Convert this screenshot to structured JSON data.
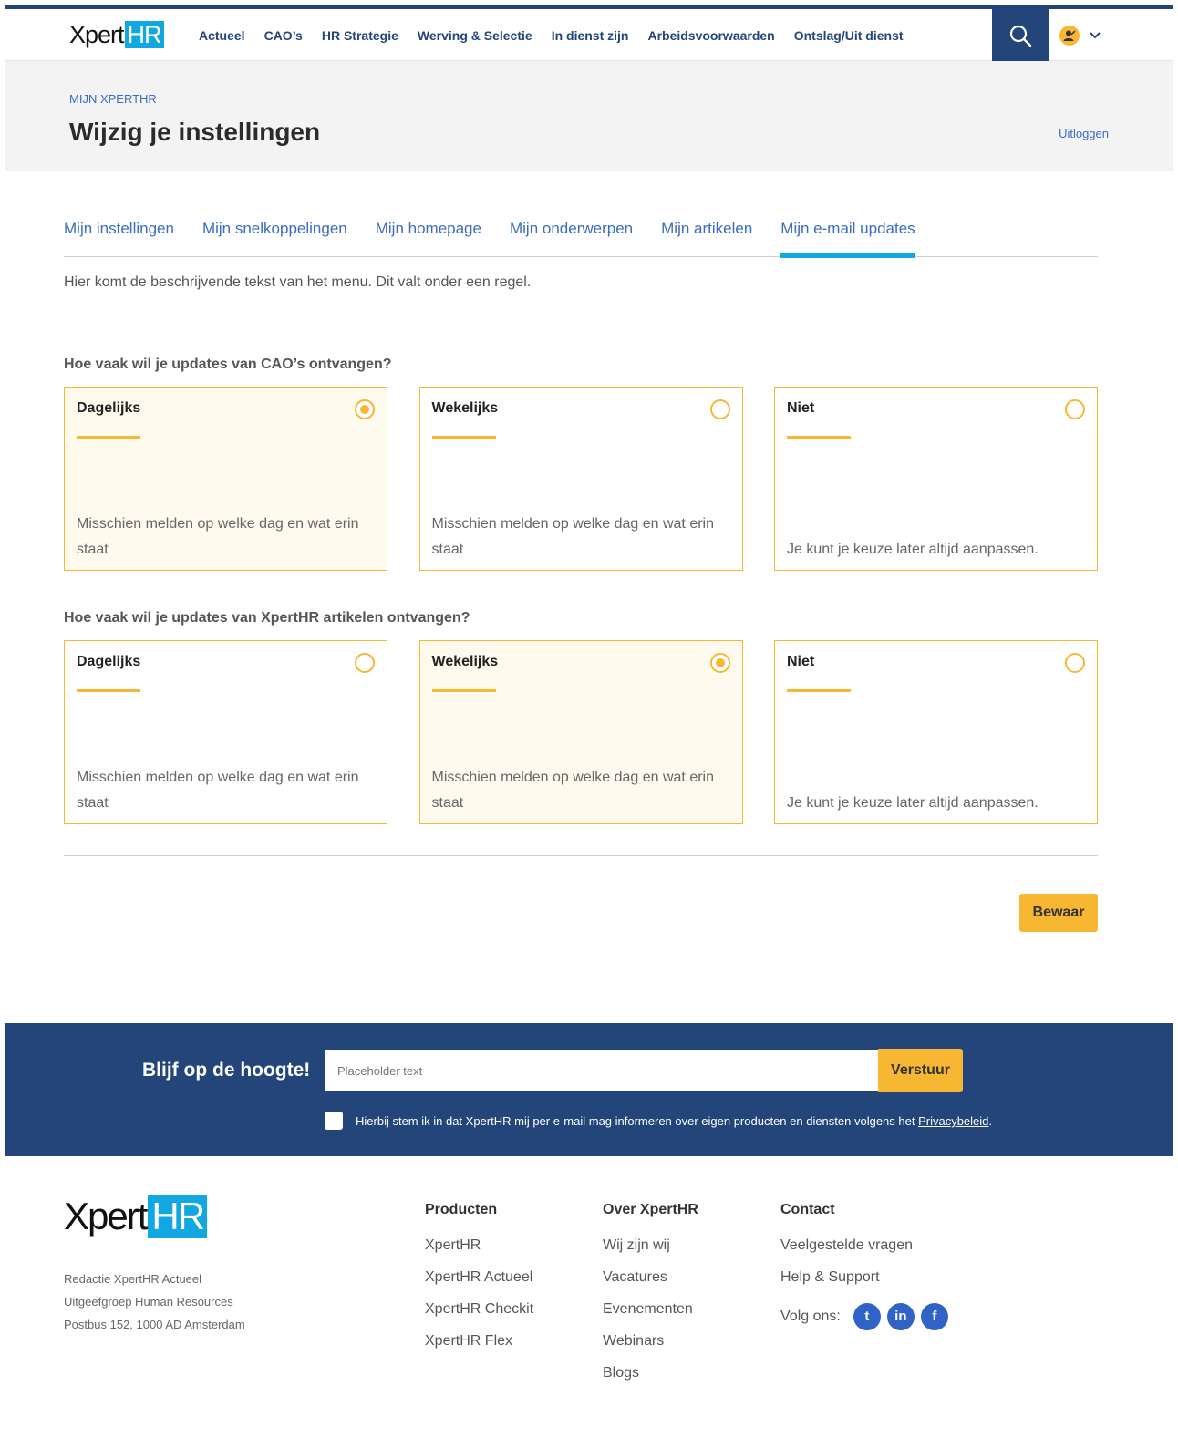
{
  "header": {
    "logo_a": "Xpert",
    "logo_b": "HR",
    "nav": [
      "Actueel",
      "CAO’s",
      "HR Strategie",
      "Werving & Selectie",
      "In dienst zijn",
      "Arbeidsvoorwaarden",
      "Ontslag/Uit dienst"
    ]
  },
  "pagehead": {
    "eyebrow": "MIJN XPERTHR",
    "title": "Wijzig je instellingen",
    "logout": "Uitloggen"
  },
  "tabs": [
    "Mijn instellingen",
    "Mijn snelkoppelingen",
    "Mijn homepage",
    "Mijn onderwerpen",
    "Mijn artikelen",
    "Mijn e-mail updates"
  ],
  "active_tab": 5,
  "intro": "Hier komt de beschrijvende tekst van het menu. Dit valt onder een regel.",
  "questions": [
    {
      "label": "Hoe vaak wil je updates van CAO’s ontvangen?",
      "options": [
        {
          "title": "Dagelijks",
          "desc": "Misschien melden op welke dag en wat erin staat",
          "selected": true
        },
        {
          "title": "Wekelijks",
          "desc": "Misschien melden op welke dag en wat erin staat",
          "selected": false
        },
        {
          "title": "Niet",
          "desc": "Je kunt je keuze later altijd aanpassen.",
          "selected": false
        }
      ]
    },
    {
      "label": "Hoe vaak wil je updates van XpertHR artikelen ontvangen?",
      "options": [
        {
          "title": "Dagelijks",
          "desc": "Misschien melden op welke dag en wat erin staat",
          "selected": false
        },
        {
          "title": "Wekelijks",
          "desc": "Misschien melden op welke dag en wat erin staat",
          "selected": true
        },
        {
          "title": "Niet",
          "desc": "Je kunt je keuze later altijd aanpassen.",
          "selected": false
        }
      ]
    }
  ],
  "save_label": "Bewaar",
  "newsletter": {
    "title": "Blijf op de hoogte!",
    "placeholder": "Placeholder text",
    "button": "Verstuur",
    "consent": "Hierbij stem ik in dat XpertHR mij per e-mail mag informeren over eigen producten en diensten volgens het ",
    "consent_link": "Privacybeleid",
    "consent_end": "."
  },
  "footer": {
    "address": [
      "Redactie XpertHR Actueel",
      "Uitgeefgroep Human Resources",
      "Postbus 152, 1000 AD Amsterdam"
    ],
    "columns": [
      {
        "title": "Producten",
        "links": [
          "XpertHR",
          "XpertHR Actueel",
          "XpertHR Checkit",
          "XpertHR Flex"
        ]
      },
      {
        "title": "Over XpertHR",
        "links": [
          "Wij zijn wij",
          "Vacatures",
          "Evenementen",
          "Webinars",
          "Blogs"
        ]
      },
      {
        "title": "Contact",
        "links": [
          "Veelgestelde vragen",
          "Help & Support"
        ]
      }
    ],
    "follow": "Volg ons:",
    "social": [
      {
        "icon": "twitter-icon",
        "glyph": "t"
      },
      {
        "icon": "linkedin-icon",
        "glyph": "in"
      },
      {
        "icon": "facebook-icon",
        "glyph": "f"
      }
    ]
  },
  "colors": {
    "navy": "#24457a",
    "accent": "#f7b733",
    "link": "#3a6cc2",
    "brand_blue": "#11a7e0"
  }
}
